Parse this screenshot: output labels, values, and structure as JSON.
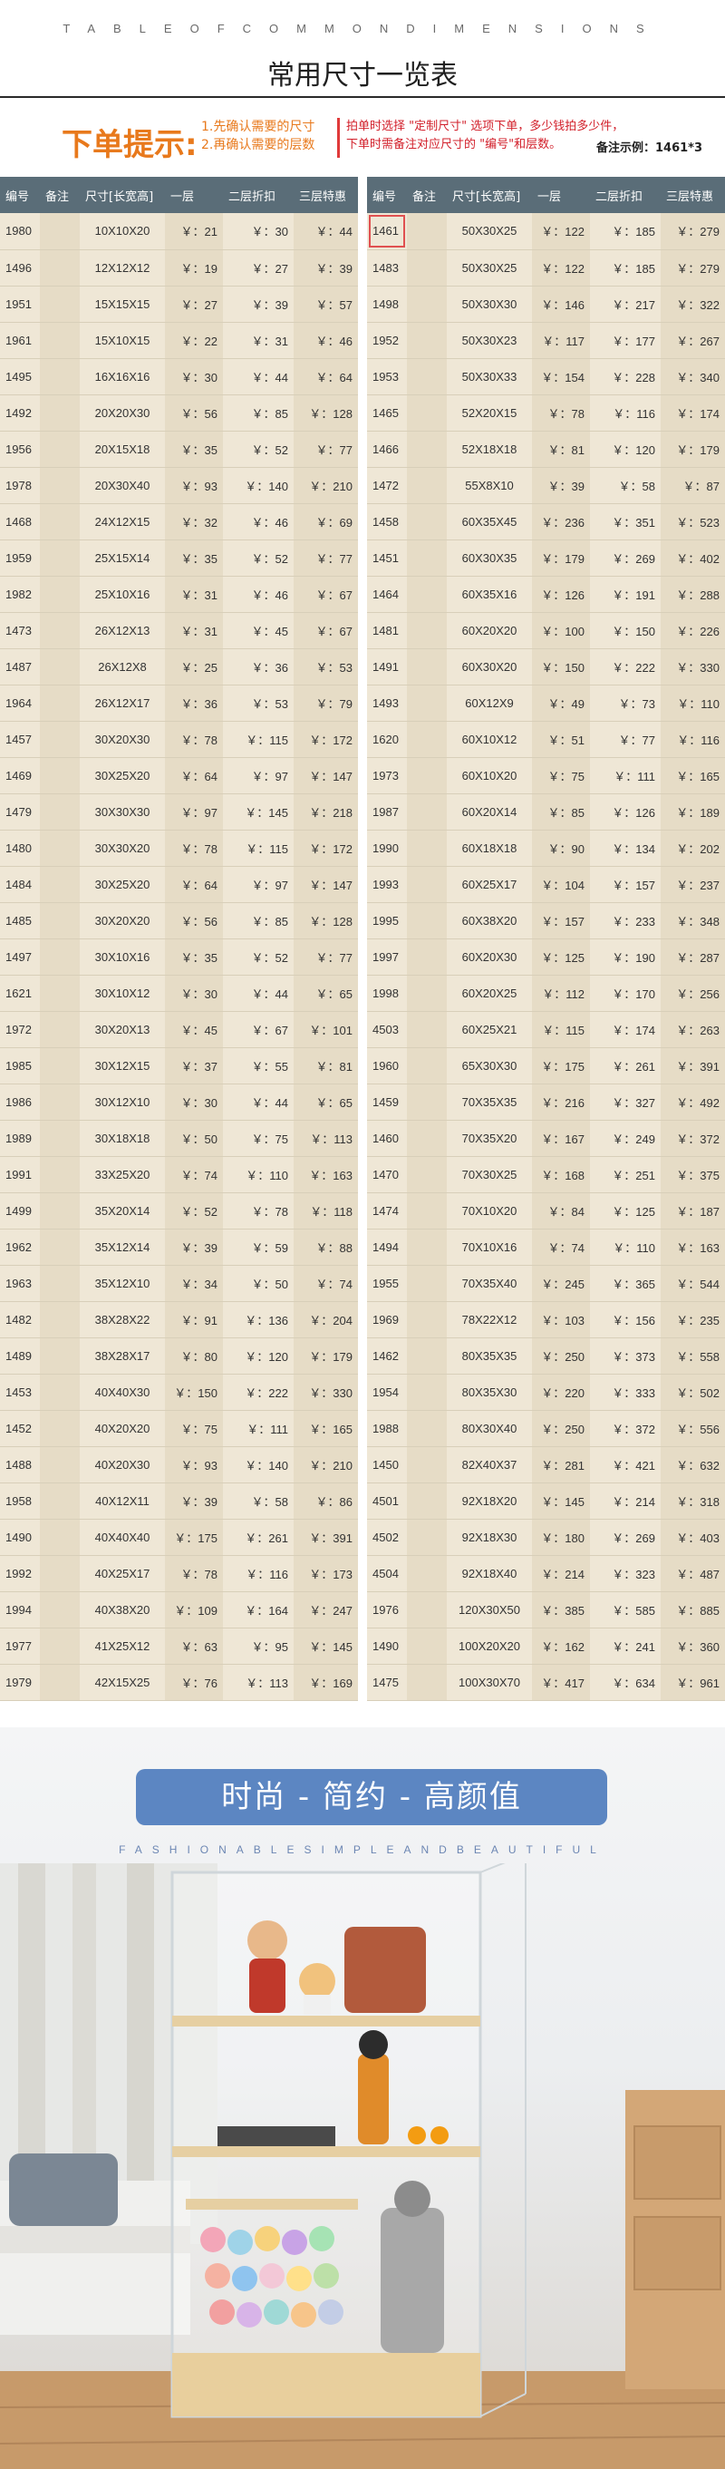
{
  "header": {
    "eng_title": "TABLEOFCOMMONDIMENSIONS",
    "cn_title": "常用尺寸一览表"
  },
  "tips": {
    "main": "下单提示:",
    "steps": [
      "1.先确认需要的尺寸",
      "2.再确认需要的层数"
    ],
    "note_line1": "拍单时选择 \"定制尺寸\" 选项下单，多少钱拍多少件，",
    "note_line2": "下单时需备注对应尺寸的 \"编号\"和层数。",
    "example": "备注示例：1461*3"
  },
  "table": {
    "headers": [
      "编号",
      "备注",
      "尺寸[长宽高]",
      "一层",
      "二层折扣",
      "三层特惠"
    ],
    "currency": "￥：",
    "left_rows": [
      [
        "1980",
        "10X10X20",
        "21",
        "30",
        "44"
      ],
      [
        "1496",
        "12X12X12",
        "19",
        "27",
        "39"
      ],
      [
        "1951",
        "15X15X15",
        "27",
        "39",
        "57"
      ],
      [
        "1961",
        "15X10X15",
        "22",
        "31",
        "46"
      ],
      [
        "1495",
        "16X16X16",
        "30",
        "44",
        "64"
      ],
      [
        "1492",
        "20X20X30",
        "56",
        "85",
        "128"
      ],
      [
        "1956",
        "20X15X18",
        "35",
        "52",
        "77"
      ],
      [
        "1978",
        "20X30X40",
        "93",
        "140",
        "210"
      ],
      [
        "1468",
        "24X12X15",
        "32",
        "46",
        "69"
      ],
      [
        "1959",
        "25X15X14",
        "35",
        "52",
        "77"
      ],
      [
        "1982",
        "25X10X16",
        "31",
        "46",
        "67"
      ],
      [
        "1473",
        "26X12X13",
        "31",
        "45",
        "67"
      ],
      [
        "1487",
        "26X12X8",
        "25",
        "36",
        "53"
      ],
      [
        "1964",
        "26X12X17",
        "36",
        "53",
        "79"
      ],
      [
        "1457",
        "30X20X30",
        "78",
        "115",
        "172"
      ],
      [
        "1469",
        "30X25X20",
        "64",
        "97",
        "147"
      ],
      [
        "1479",
        "30X30X30",
        "97",
        "145",
        "218"
      ],
      [
        "1480",
        "30X30X20",
        "78",
        "115",
        "172"
      ],
      [
        "1484",
        "30X25X20",
        "64",
        "97",
        "147"
      ],
      [
        "1485",
        "30X20X20",
        "56",
        "85",
        "128"
      ],
      [
        "1497",
        "30X10X16",
        "35",
        "52",
        "77"
      ],
      [
        "1621",
        "30X10X12",
        "30",
        "44",
        "65"
      ],
      [
        "1972",
        "30X20X13",
        "45",
        "67",
        "101"
      ],
      [
        "1985",
        "30X12X15",
        "37",
        "55",
        "81"
      ],
      [
        "1986",
        "30X12X10",
        "30",
        "44",
        "65"
      ],
      [
        "1989",
        "30X18X18",
        "50",
        "75",
        "113"
      ],
      [
        "1991",
        "33X25X20",
        "74",
        "110",
        "163"
      ],
      [
        "1499",
        "35X20X14",
        "52",
        "78",
        "118"
      ],
      [
        "1962",
        "35X12X14",
        "39",
        "59",
        "88"
      ],
      [
        "1963",
        "35X12X10",
        "34",
        "50",
        "74"
      ],
      [
        "1482",
        "38X28X22",
        "91",
        "136",
        "204"
      ],
      [
        "1489",
        "38X28X17",
        "80",
        "120",
        "179"
      ],
      [
        "1453",
        "40X40X30",
        "150",
        "222",
        "330"
      ],
      [
        "1452",
        "40X20X20",
        "75",
        "111",
        "165"
      ],
      [
        "1488",
        "40X20X30",
        "93",
        "140",
        "210"
      ],
      [
        "1958",
        "40X12X11",
        "39",
        "58",
        "86"
      ],
      [
        "1490",
        "40X40X40",
        "175",
        "261",
        "391"
      ],
      [
        "1992",
        "40X25X17",
        "78",
        "116",
        "173"
      ],
      [
        "1994",
        "40X38X20",
        "109",
        "164",
        "247"
      ],
      [
        "1977",
        "41X25X12",
        "63",
        "95",
        "145"
      ],
      [
        "1979",
        "42X15X25",
        "76",
        "113",
        "169"
      ]
    ],
    "right_rows": [
      [
        "1461",
        "50X30X25",
        "122",
        "185",
        "279"
      ],
      [
        "1483",
        "50X30X25",
        "122",
        "185",
        "279"
      ],
      [
        "1498",
        "50X30X30",
        "146",
        "217",
        "322"
      ],
      [
        "1952",
        "50X30X23",
        "117",
        "177",
        "267"
      ],
      [
        "1953",
        "50X30X33",
        "154",
        "228",
        "340"
      ],
      [
        "1465",
        "52X20X15",
        "78",
        "116",
        "174"
      ],
      [
        "1466",
        "52X18X18",
        "81",
        "120",
        "179"
      ],
      [
        "1472",
        "55X8X10",
        "39",
        "58",
        "87"
      ],
      [
        "1458",
        "60X35X45",
        "236",
        "351",
        "523"
      ],
      [
        "1451",
        "60X30X35",
        "179",
        "269",
        "402"
      ],
      [
        "1464",
        "60X35X16",
        "126",
        "191",
        "288"
      ],
      [
        "1481",
        "60X20X20",
        "100",
        "150",
        "226"
      ],
      [
        "1491",
        "60X30X20",
        "150",
        "222",
        "330"
      ],
      [
        "1493",
        "60X12X9",
        "49",
        "73",
        "110"
      ],
      [
        "1620",
        "60X10X12",
        "51",
        "77",
        "116"
      ],
      [
        "1973",
        "60X10X20",
        "75",
        "111",
        "165"
      ],
      [
        "1987",
        "60X20X14",
        "85",
        "126",
        "189"
      ],
      [
        "1990",
        "60X18X18",
        "90",
        "134",
        "202"
      ],
      [
        "1993",
        "60X25X17",
        "104",
        "157",
        "237"
      ],
      [
        "1995",
        "60X38X20",
        "157",
        "233",
        "348"
      ],
      [
        "1997",
        "60X20X30",
        "125",
        "190",
        "287"
      ],
      [
        "1998",
        "60X20X25",
        "112",
        "170",
        "256"
      ],
      [
        "4503",
        "60X25X21",
        "115",
        "174",
        "263"
      ],
      [
        "1960",
        "65X30X30",
        "175",
        "261",
        "391"
      ],
      [
        "1459",
        "70X35X35",
        "216",
        "327",
        "492"
      ],
      [
        "1460",
        "70X35X20",
        "167",
        "249",
        "372"
      ],
      [
        "1470",
        "70X30X25",
        "168",
        "251",
        "375"
      ],
      [
        "1474",
        "70X10X20",
        "84",
        "125",
        "187"
      ],
      [
        "1494",
        "70X10X16",
        "74",
        "110",
        "163"
      ],
      [
        "1955",
        "70X35X40",
        "245",
        "365",
        "544"
      ],
      [
        "1969",
        "78X22X12",
        "103",
        "156",
        "235"
      ],
      [
        "1462",
        "80X35X35",
        "250",
        "373",
        "558"
      ],
      [
        "1954",
        "80X35X30",
        "220",
        "333",
        "502"
      ],
      [
        "1988",
        "80X30X40",
        "250",
        "372",
        "556"
      ],
      [
        "1450",
        "82X40X37",
        "281",
        "421",
        "632"
      ],
      [
        "4501",
        "92X18X20",
        "145",
        "214",
        "318"
      ],
      [
        "4502",
        "92X18X30",
        "180",
        "269",
        "403"
      ],
      [
        "4504",
        "92X18X40",
        "214",
        "323",
        "487"
      ],
      [
        "1976",
        "120X30X50",
        "385",
        "585",
        "885"
      ],
      [
        "1490",
        "100X20X20",
        "162",
        "241",
        "360"
      ],
      [
        "1475",
        "100X30X70",
        "417",
        "634",
        "961"
      ]
    ]
  },
  "promo": {
    "banner": "时尚 - 简约 - 高颜值",
    "sub": "FASHIONABLESIMPLEANDBEAUTIFUL"
  },
  "colors": {
    "header_bg": "#5a6d78",
    "row_bg": "#efe7d6",
    "tip_orange": "#e8791c",
    "tip_red": "#d21f2a",
    "banner_blue": "#5c86c2"
  }
}
